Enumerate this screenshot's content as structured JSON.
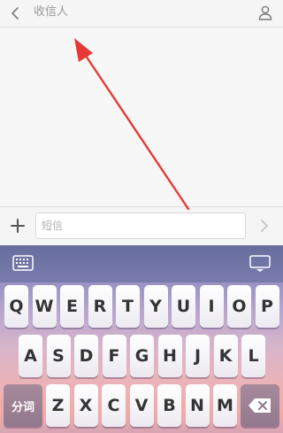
{
  "header": {
    "recipient_placeholder": "收信人",
    "back_icon": "chevron-left-icon",
    "contact_icon": "person-icon"
  },
  "compose": {
    "add_icon": "plus-icon",
    "message_placeholder": "短信",
    "send_icon": "chevron-right-icon"
  },
  "annotation": {
    "color": "#e53935",
    "points_to": "recipient-field"
  },
  "keyboard": {
    "switch_icon": "keyboard-icon",
    "hide_icon": "hide-keyboard-icon",
    "row1": [
      "Q",
      "W",
      "E",
      "R",
      "T",
      "Y",
      "U",
      "I",
      "O",
      "P"
    ],
    "row2": [
      "A",
      "S",
      "D",
      "F",
      "G",
      "H",
      "J",
      "K",
      "L"
    ],
    "row3": [
      "Z",
      "X",
      "C",
      "V",
      "B",
      "N",
      "M"
    ],
    "segment_label": "分词",
    "backspace_icon": "backspace-icon"
  }
}
